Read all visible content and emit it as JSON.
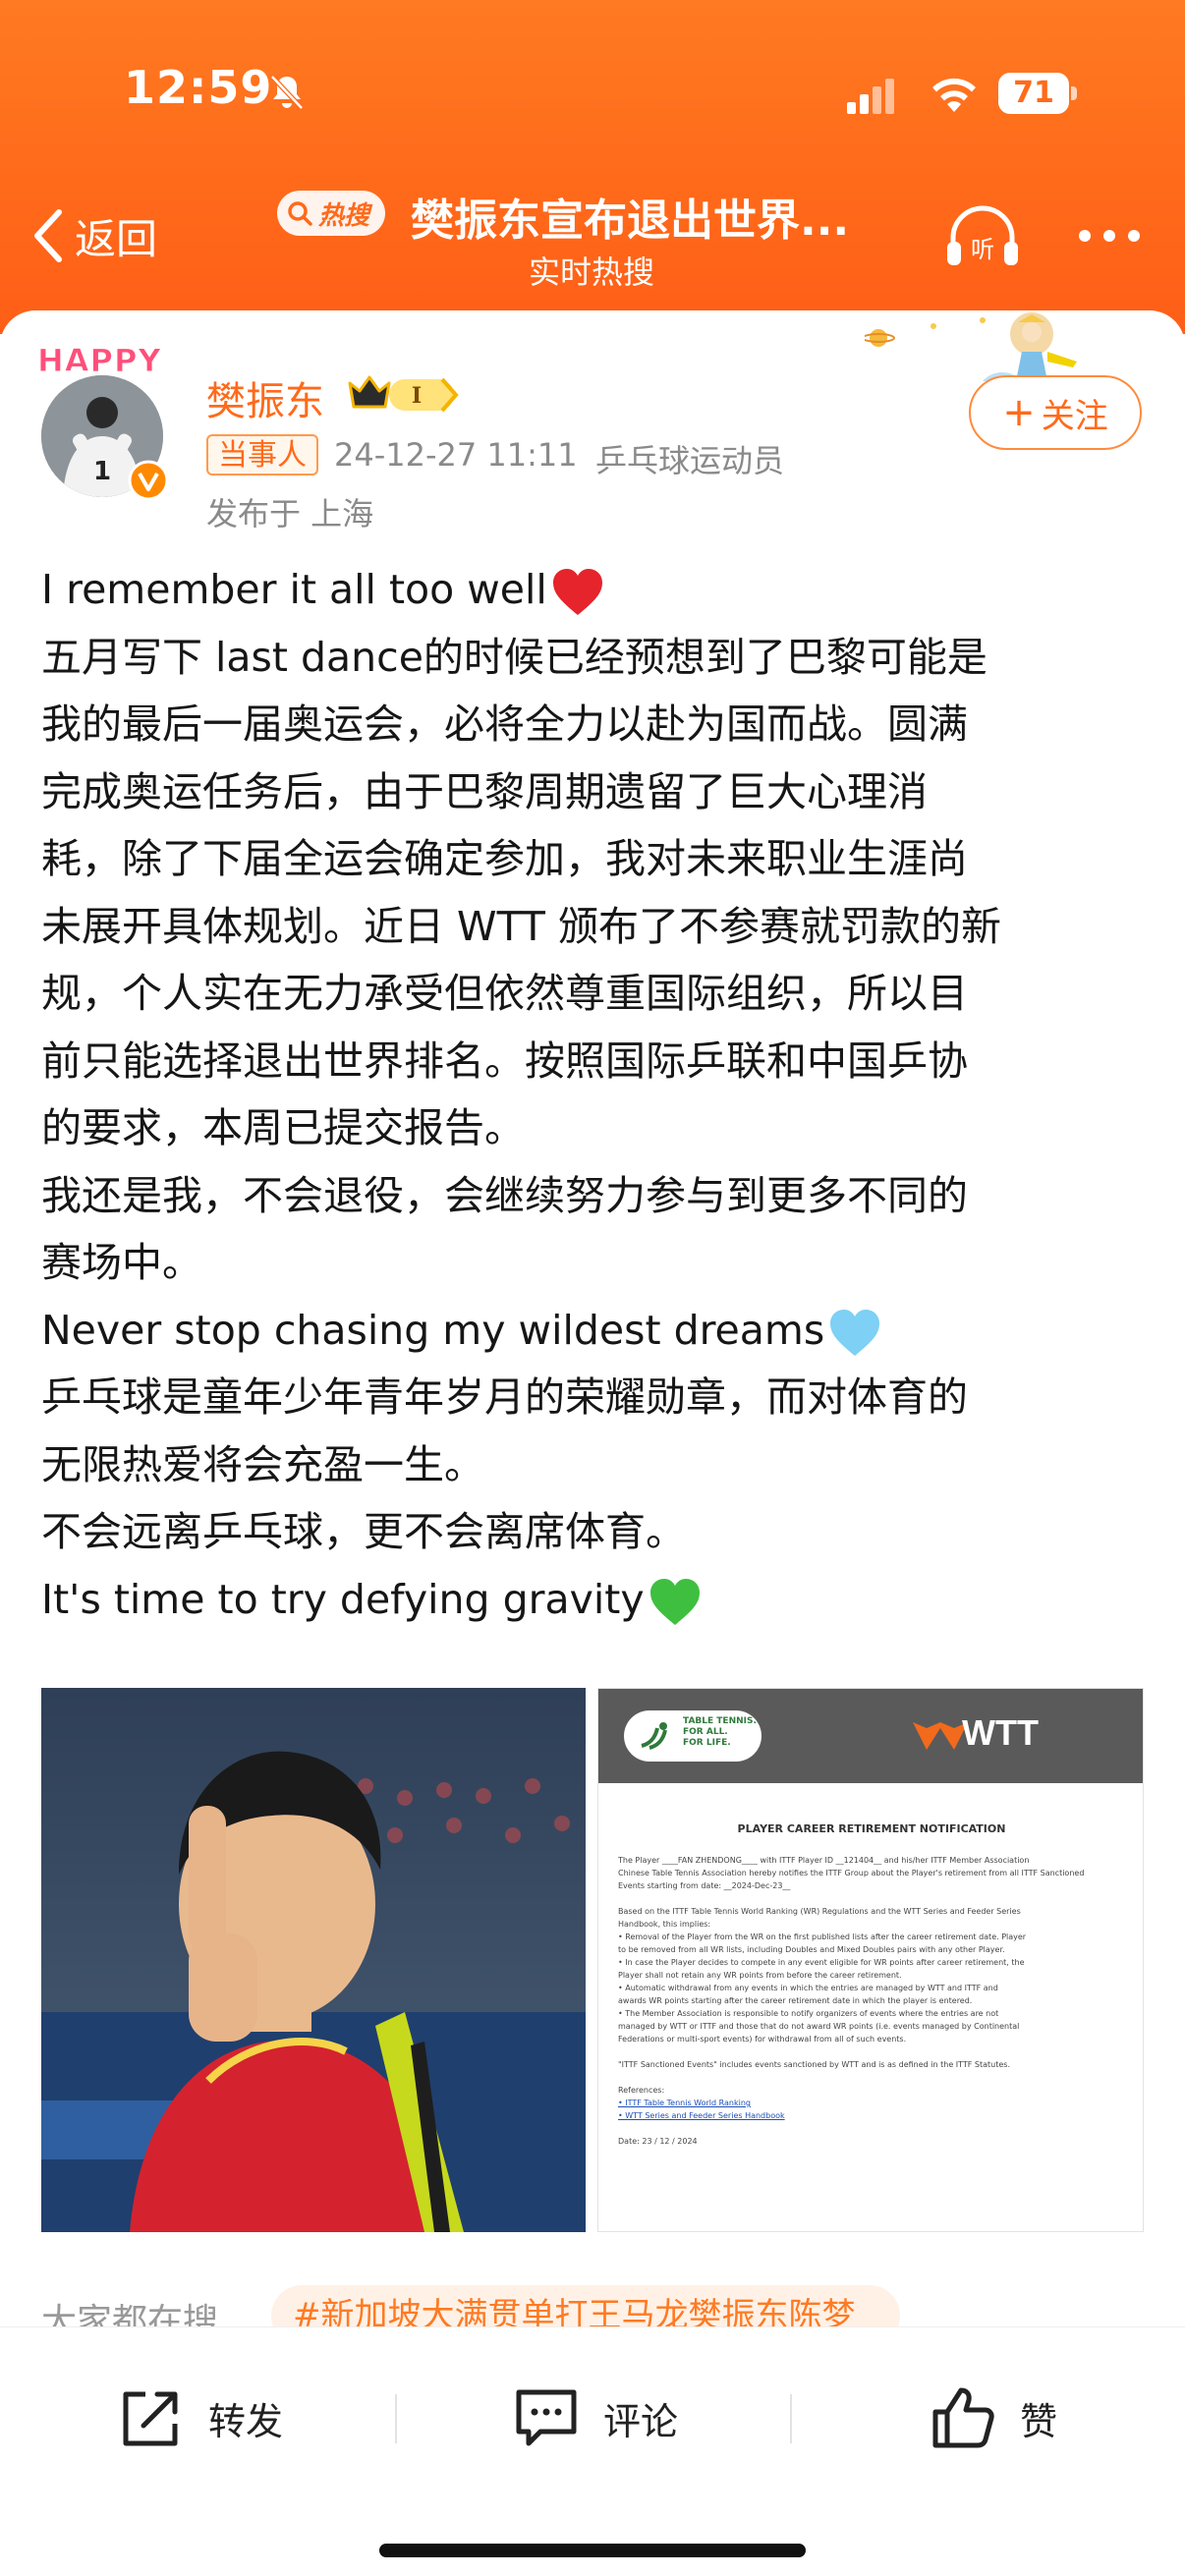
{
  "status_bar": {
    "time": "12:59",
    "battery": "71"
  },
  "nav": {
    "back_label": "返回",
    "hot_badge": "热搜",
    "title": "樊振东宣布退出世界...",
    "subtitle": "实时热搜"
  },
  "post": {
    "avatar_banner": "HAPPY",
    "username": "樊振东",
    "vip_level": "I",
    "tag": "当事人",
    "time": "24-12-27 11:11",
    "job": "乒乓球运动员",
    "location": "发布于 上海",
    "follow_label": "关注",
    "lines": [
      "I remember it all too well",
      "五月写下 last dance的时候已经预想到了巴黎可能是",
      "我的最后一届奥运会，必将全力以赴为国而战。圆满",
      "完成奥运任务后，由于巴黎周期遗留了巨大心理消",
      "耗，除了下届全运会确定参加，我对未来职业生涯尚",
      "未展开具体规划。近日 WTT 颁布了不参赛就罚款的新",
      "规，个人实在无力承受但依然尊重国际组织，所以目",
      "前只能选择退出世界排名。按照国际乒联和中国乒协",
      "的要求，本周已提交报告。",
      "我还是我，不会退役，会继续努力参与到更多不同的",
      "赛场中。",
      "Never stop chasing my wildest dreams",
      "乒乓球是童年少年青年岁月的荣耀勋章，而对体育的",
      "无限热爱将会充盈一生。",
      "不会远离乒乓球，更不会离席体育。",
      "It's time to try defying gravity"
    ],
    "emoji_colors": {
      "line0": "#e5242b",
      "line11": "#7ed0f4",
      "line15": "#3fbf3f"
    }
  },
  "document": {
    "ittf_text": [
      "TABLE TENNIS.",
      "FOR ALL.",
      "FOR LIFE."
    ],
    "wtt_logo": "WTT",
    "title": "PLAYER CAREER RETIREMENT NOTIFICATION",
    "body": [
      "The Player ____FAN ZHENDONG____ with ITTF Player ID __121404__ and his/her ITTF Member Association",
      "Chinese Table Tennis Association hereby notifies the ITTF Group about the Player's retirement from all ITTF Sanctioned",
      "Events starting from date: __2024-Dec-23__",
      "",
      "Based on the ITTF Table Tennis World Ranking (WR) Regulations and the WTT Series and Feeder Series",
      "Handbook, this implies:",
      "• Removal of the Player from the WR on the first published lists after the career retirement date. Player",
      "  to be removed from all WR lists, including Doubles and Mixed Doubles pairs with any other Player.",
      "• In case the Player decides to compete in any event eligible for WR points after career retirement, the",
      "  Player shall not retain any WR points from before the career retirement.",
      "• Automatic withdrawal from any events in which the entries are managed by WTT and ITTF and",
      "  awards WR points starting after the career retirement date in which the player is entered.",
      "• The Member Association is responsible to notify organizers of events where the entries are not",
      "  managed by WTT or ITTF and those that do not award WR points (i.e. events managed by Continental",
      "  Federations or multi-sport events) for withdrawal from all of such events.",
      "",
      "\"ITTF Sanctioned Events\" includes events sanctioned by WTT and is as defined in the ITTF Statutes.",
      "",
      "References:",
      "• ITTF Table Tennis World Ranking",
      "• WTT Series and Feeder Series Handbook",
      "",
      "Date:   23 / 12 / 2024"
    ]
  },
  "related": {
    "label": "大家都在搜",
    "tag": "#新加坡大满贯单打王马龙樊振东陈梦"
  },
  "actions": {
    "repost": "转发",
    "comment": "评论",
    "like": "赞"
  },
  "colors": {
    "header": "#ff6a1a",
    "accent": "#ff6a1a"
  }
}
